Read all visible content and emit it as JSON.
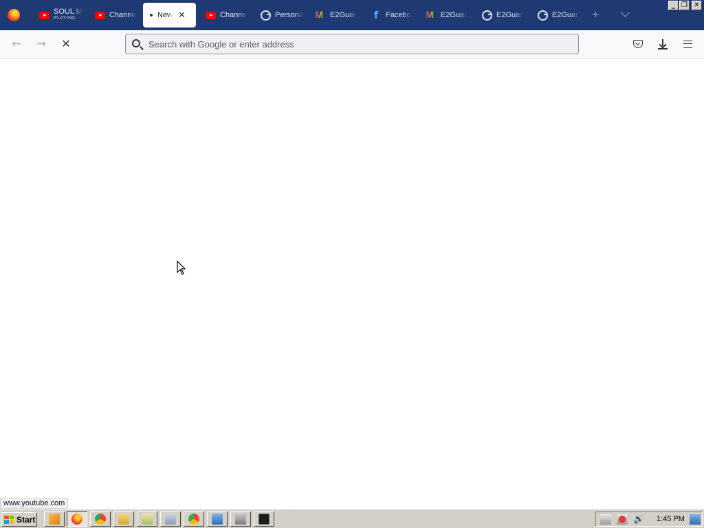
{
  "window": {
    "minimize": "_",
    "restore": "❐",
    "close": "✕"
  },
  "tabs": [
    {
      "favicon": "youtube-icon",
      "label": "SOUL M",
      "sub": "PLAYING"
    },
    {
      "favicon": "youtube-icon",
      "label": "Channe"
    },
    {
      "favicon": "dot",
      "label": "New",
      "selected": true,
      "close": "✕"
    },
    {
      "favicon": "youtube-icon",
      "label": "Channe"
    },
    {
      "favicon": "google-icon",
      "label": "Persona"
    },
    {
      "favicon": "gmail-icon",
      "label": "E2Guar"
    },
    {
      "favicon": "facebook-icon",
      "label": "Facebo"
    },
    {
      "favicon": "gmail-icon",
      "label": "E2Guar"
    },
    {
      "favicon": "google-icon",
      "label": "E2Guar"
    },
    {
      "favicon": "google-icon",
      "label": "E2Guar"
    }
  ],
  "toolbar": {
    "back": "←",
    "forward": "→",
    "stop": "✕",
    "url_placeholder": "Search with Google or enter address",
    "new_tab": "+"
  },
  "status_text": "www.youtube.com",
  "taskbar": {
    "start_label": "Start",
    "clock": "1:45 PM"
  }
}
